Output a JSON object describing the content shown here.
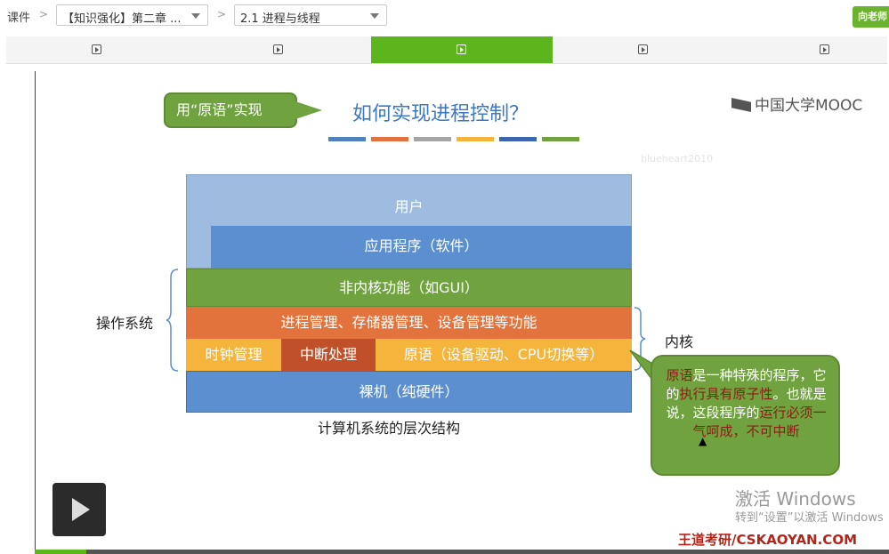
{
  "topbar": {
    "label": "课件",
    "dropdown_chapter": "【知识强化】第二章 ...",
    "dropdown_section": "2.1 进程与线程",
    "ask_button": "向老师"
  },
  "tabs": [
    {
      "icon": "play-icon",
      "active": false
    },
    {
      "icon": "play-icon",
      "active": false
    },
    {
      "icon": "play-icon",
      "active": true
    },
    {
      "icon": "play-icon",
      "active": false
    },
    {
      "icon": "play-icon",
      "active": false
    }
  ],
  "slide": {
    "callout_top": "用“原语”实现",
    "title": "如何实现进程控制？",
    "logo": "中国大学MOOC",
    "watermark": "blueheart2010",
    "title_bar_colors": [
      "#4f81bd",
      "#e2733c",
      "#a5a5a5",
      "#f5b43c",
      "#3d65ae",
      "#70a33f"
    ],
    "layers": {
      "user": "用户",
      "app": "应用程序（软件）",
      "nonkernel": "非内核功能（如GUI）",
      "process_mgmt": "进程管理、存储器管理、设备管理等功能",
      "clock": "时钟管理",
      "interrupt": "中断处理",
      "primitive": "原语（设备驱动、CPU切换等）",
      "bare": "裸机（纯硬件）"
    },
    "os_label": "操作系统",
    "kernel_label": "内核",
    "caption": "计算机系统的层次结构",
    "callout_right": {
      "p1": "原语",
      "p2": "是一种特殊的程序，它的",
      "p3": "执行具有原子性",
      "p4": "。也就是说，这段程序的",
      "p5": "运行必须一气呵成，不可中断"
    },
    "activate_line1": "激活 Windows",
    "activate_line2": "转到“设置”以激活 Windows",
    "site": "王道考研/CSKAOYAN.COM"
  },
  "player": {
    "progress": 0.06
  }
}
